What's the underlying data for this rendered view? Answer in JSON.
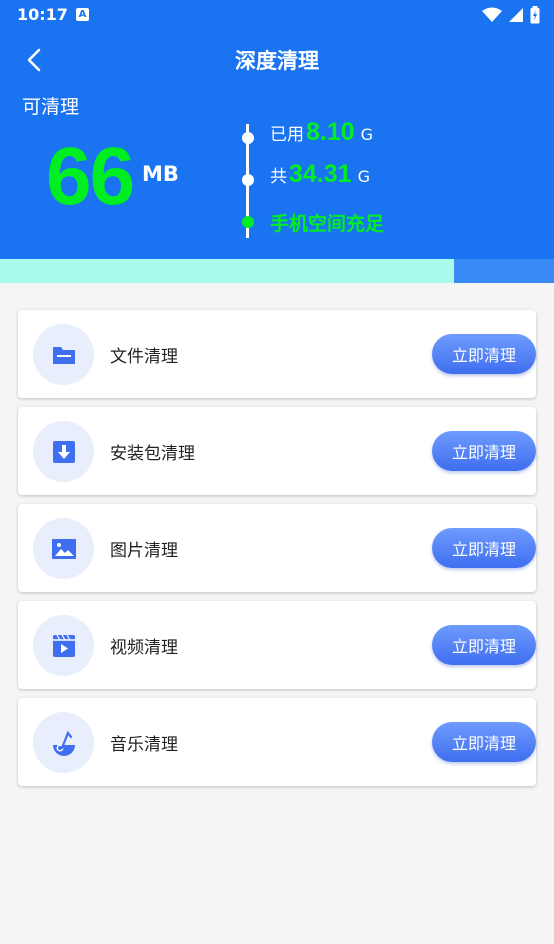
{
  "status_bar": {
    "time": "10:17",
    "notification_letter": "A"
  },
  "header": {
    "title": "深度清理",
    "cleanable_label": "可清理",
    "cleanable_value": "66",
    "cleanable_unit": "MB",
    "used_label": "已用",
    "used_value": "8.10",
    "used_unit": "G",
    "total_label": "共",
    "total_value": "34.31",
    "total_unit": "G",
    "storage_status": "手机空间充足",
    "accent_color": "#00ee22",
    "brand_color": "#1a73f0"
  },
  "progress": {
    "used_fraction": 0.82
  },
  "items": [
    {
      "label": "文件清理",
      "icon": "folder-icon",
      "button": "立即清理"
    },
    {
      "label": "安装包清理",
      "icon": "download-package-icon",
      "button": "立即清理"
    },
    {
      "label": "图片清理",
      "icon": "image-icon",
      "button": "立即清理"
    },
    {
      "label": "视频清理",
      "icon": "video-icon",
      "button": "立即清理"
    },
    {
      "label": "音乐清理",
      "icon": "music-icon",
      "button": "立即清理"
    }
  ]
}
